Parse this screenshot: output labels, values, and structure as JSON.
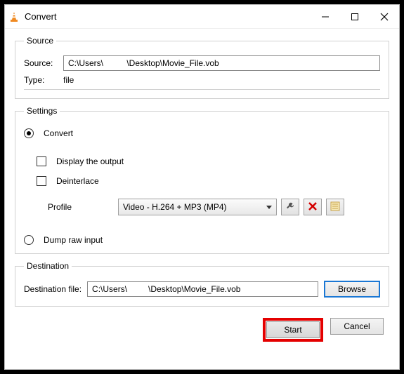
{
  "window": {
    "title": "Convert"
  },
  "source": {
    "legend": "Source",
    "source_label": "Source:",
    "source_value": "C:\\Users\\          \\Desktop\\Movie_File.vob",
    "type_label": "Type:",
    "type_value": "file"
  },
  "settings": {
    "legend": "Settings",
    "convert_label": "Convert",
    "display_output_label": "Display the output",
    "deinterlace_label": "Deinterlace",
    "profile_label": "Profile",
    "profile_selected": "Video - H.264 + MP3 (MP4)",
    "dump_raw_label": "Dump raw input"
  },
  "destination": {
    "legend": "Destination",
    "file_label": "Destination file:",
    "file_value": "C:\\Users\\         \\Desktop\\Movie_File.vob",
    "browse_label": "Browse"
  },
  "footer": {
    "start_label": "Start",
    "cancel_label": "Cancel"
  }
}
